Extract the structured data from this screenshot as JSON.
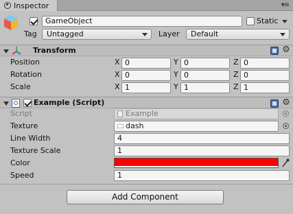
{
  "tab": {
    "title": "Inspector"
  },
  "object": {
    "name": "GameObject",
    "active": true,
    "static_label": "Static",
    "static_checked": false,
    "tag_label": "Tag",
    "tag_value": "Untagged",
    "layer_label": "Layer",
    "layer_value": "Default"
  },
  "transform": {
    "title": "Transform",
    "rows": [
      {
        "label": "Position",
        "x": "0",
        "y": "0",
        "z": "0"
      },
      {
        "label": "Rotation",
        "x": "0",
        "y": "0",
        "z": "0"
      },
      {
        "label": "Scale",
        "x": "1",
        "y": "1",
        "z": "1"
      }
    ],
    "axis": {
      "x": "X",
      "y": "Y",
      "z": "Z"
    }
  },
  "script": {
    "title": "Example (Script)",
    "enabled": true,
    "script_label": "Script",
    "script_value": "Example",
    "texture_label": "Texture",
    "texture_value": "dash",
    "line_width_label": "Line Width",
    "line_width_value": "4",
    "texture_scale_label": "Texture Scale",
    "texture_scale_value": "1",
    "color_label": "Color",
    "color_value": "#ff0000",
    "speed_label": "Speed",
    "speed_value": "1"
  },
  "add_component": {
    "label": "Add Component"
  }
}
